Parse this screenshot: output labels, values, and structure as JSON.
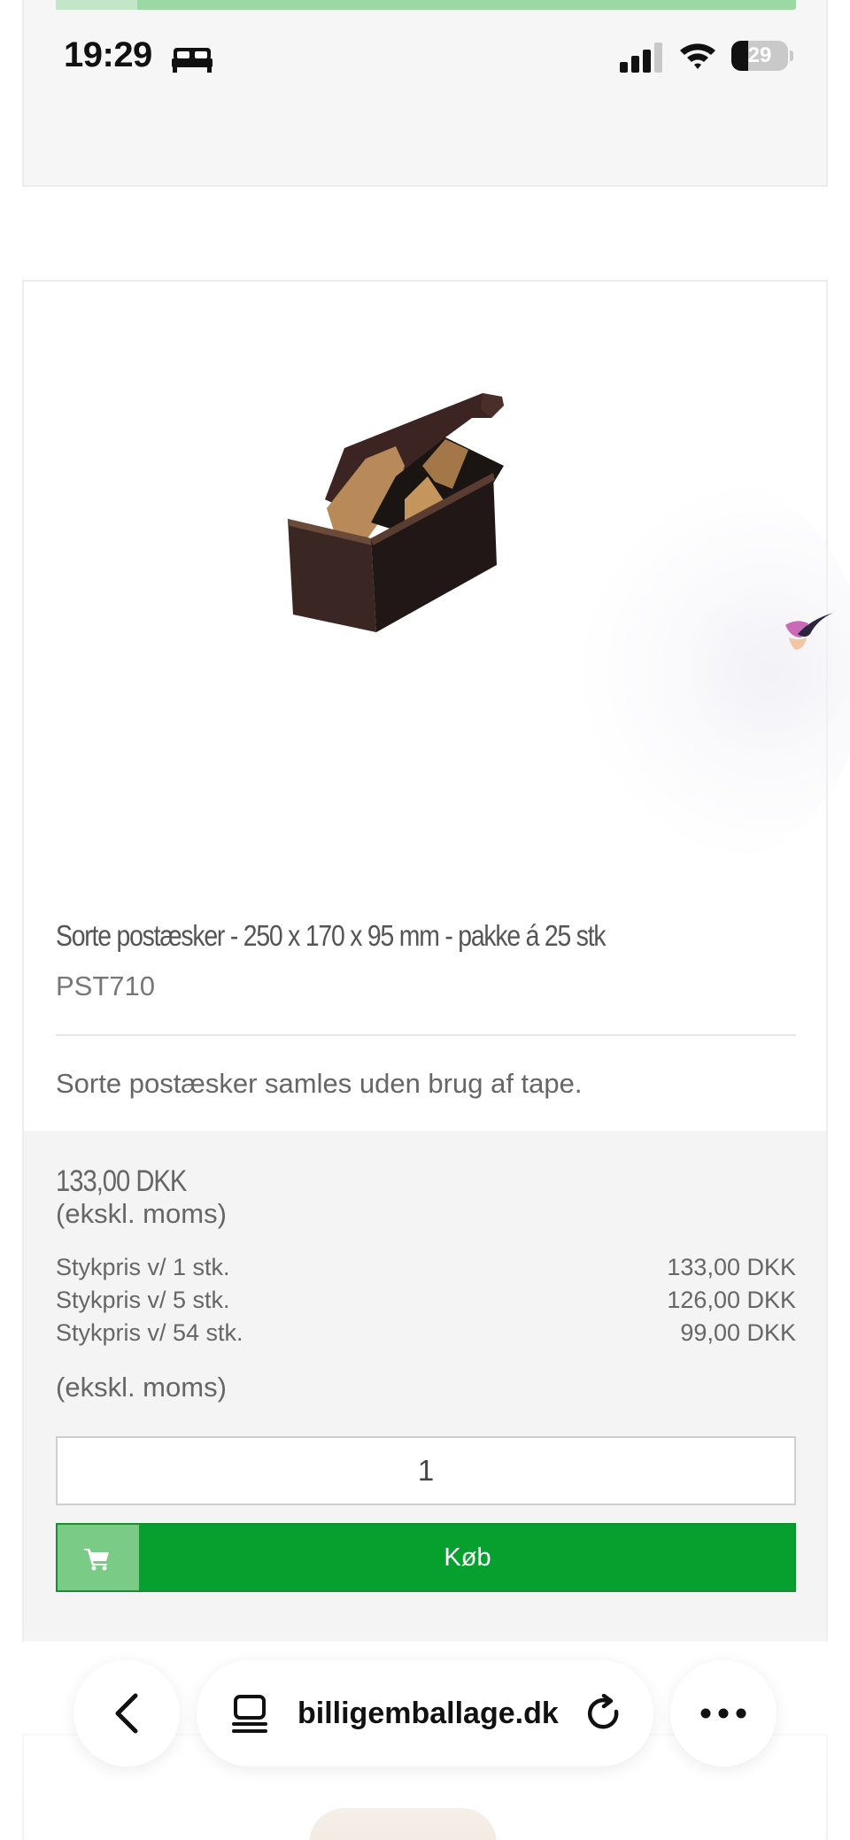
{
  "status_bar": {
    "time": "19:29",
    "battery": "29",
    "icons": [
      "bed-icon",
      "cellular-signal-icon",
      "wifi-icon",
      "battery-icon"
    ]
  },
  "product": {
    "title": "Sorte postæsker - 250 x 170 x 95 mm - pakke á 25 stk",
    "sku": "PST710",
    "description": "Sorte postæsker samles uden brug af tape.",
    "price": "133,00 DKK",
    "price_note": "(ekskl. moms)",
    "tiers": [
      {
        "label": "Stykpris v/ 1 stk.",
        "value": "133,00 DKK"
      },
      {
        "label": "Stykpris v/ 5 stk.",
        "value": "126,00 DKK"
      },
      {
        "label": "Stykpris v/ 54 stk.",
        "value": "99,00 DKK"
      }
    ],
    "price_note_2": "(ekskl. moms)",
    "quantity": "1",
    "buy_label": "Køb"
  },
  "browser": {
    "url": "billigemballage.dk",
    "icons": [
      "back-arrow-icon",
      "tabs-icon",
      "reload-icon",
      "more-icon"
    ]
  },
  "colors": {
    "buy_green": "#06a02f",
    "cart_green": "#79cb86",
    "price_area_bg": "#f4f4f4"
  }
}
